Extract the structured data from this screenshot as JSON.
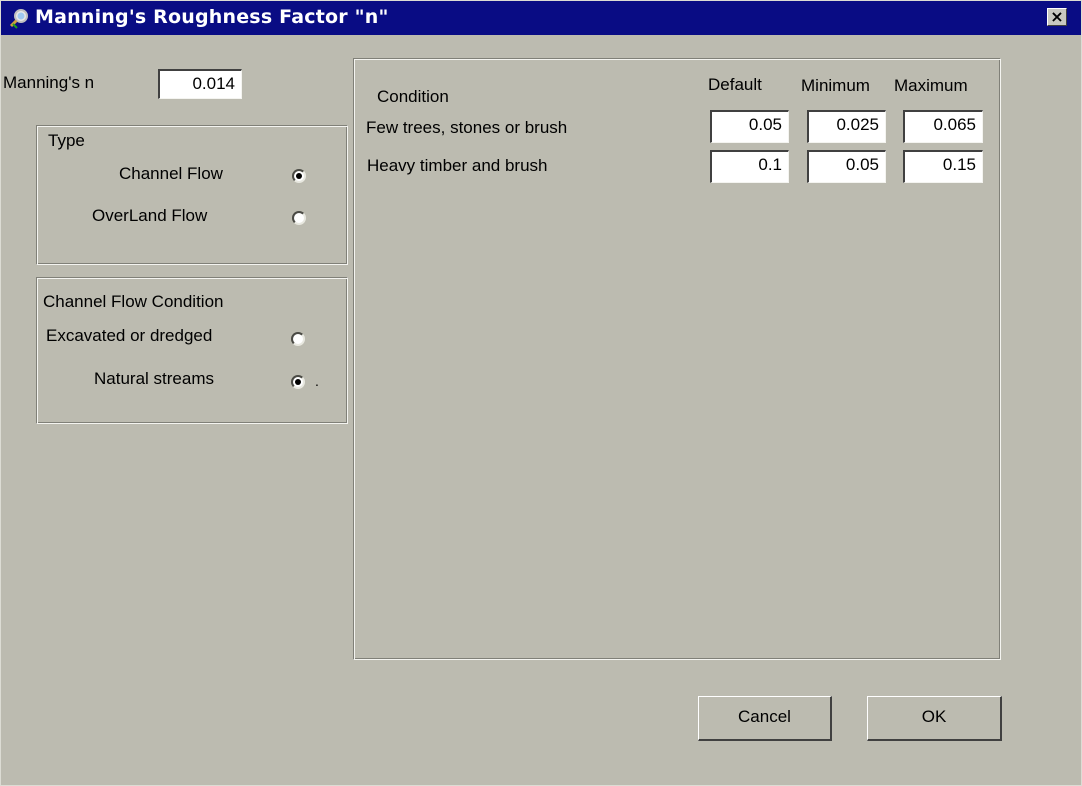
{
  "window": {
    "title": "Manning's Roughness Factor \"n\"",
    "close_label": "×"
  },
  "mannings": {
    "label": "Manning's n",
    "value": "0.014"
  },
  "type_group": {
    "title": "Type",
    "options": [
      {
        "label": "Channel Flow",
        "selected": true
      },
      {
        "label": "OverLand Flow",
        "selected": false
      }
    ]
  },
  "condition_group": {
    "title": "Channel Flow Condition",
    "options": [
      {
        "label": "Excavated or dredged",
        "selected": false
      },
      {
        "label": "Natural streams",
        "selected": true
      }
    ],
    "trailing_mark": "."
  },
  "table": {
    "condition_header": "Condition",
    "columns": [
      "Default",
      "Minimum",
      "Maximum"
    ],
    "rows": [
      {
        "label": "Few trees, stones or brush",
        "values": [
          "0.05",
          "0.025",
          "0.065"
        ]
      },
      {
        "label": "Heavy timber and brush",
        "values": [
          "0.1",
          "0.05",
          "0.15"
        ]
      }
    ]
  },
  "buttons": {
    "cancel": "Cancel",
    "ok": "OK"
  },
  "colors": {
    "titlebar": "#090c84",
    "face": "#bcbbb0"
  },
  "icons": {
    "title": "magnifier-icon",
    "close": "close-icon"
  }
}
